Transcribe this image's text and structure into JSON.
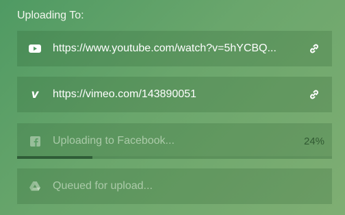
{
  "heading": "Uploading To:",
  "items": [
    {
      "service": "youtube",
      "icon": "youtube-icon",
      "text": "https://www.youtube.com/watch?v=5hYCBQ...",
      "action_icon": "link-icon"
    },
    {
      "service": "vimeo",
      "icon": "vimeo-icon",
      "text": "https://vimeo.com/143890051",
      "action_icon": "link-icon"
    },
    {
      "service": "facebook",
      "icon": "facebook-icon",
      "text": "Uploading to Facebook...",
      "progress_text": "24%",
      "progress": 0.24
    },
    {
      "service": "google-drive",
      "icon": "google-drive-icon",
      "text": "Queued for upload..."
    }
  ],
  "colors": {
    "progress_fill": "#2f5d37"
  }
}
